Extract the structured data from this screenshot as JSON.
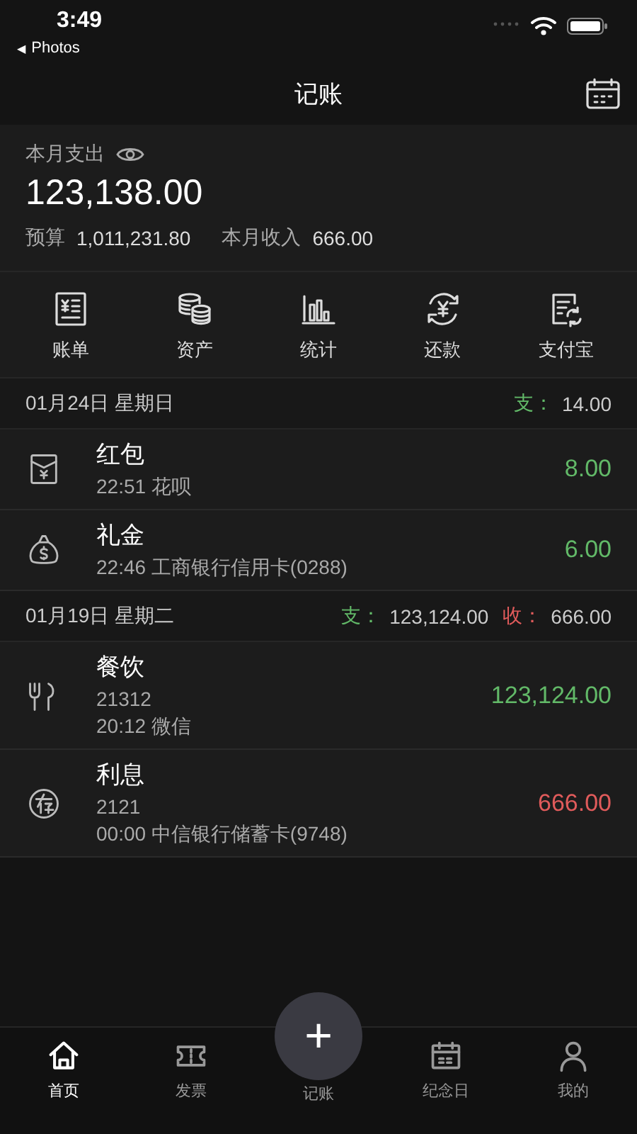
{
  "status_bar": {
    "time": "3:49",
    "back_arrow": "◀",
    "back_label": "Photos"
  },
  "nav": {
    "title": "记账"
  },
  "summary": {
    "label": "本月支出",
    "amount": "123,138.00",
    "budget_label": "预算",
    "budget": "1,011,231.80",
    "income_label": "本月收入",
    "income": "666.00"
  },
  "shortcuts": [
    {
      "label": "账单"
    },
    {
      "label": "资产"
    },
    {
      "label": "统计"
    },
    {
      "label": "还款"
    },
    {
      "label": "支付宝"
    }
  ],
  "days": [
    {
      "date": "01月24日",
      "weekday": "星期日",
      "totals": [
        {
          "kind": "expense",
          "label": "支：",
          "value": "14.00"
        }
      ],
      "entries": [
        {
          "kind": "expense",
          "category": "红包",
          "detail": "22:51 花呗",
          "amount": "8.00"
        },
        {
          "kind": "expense",
          "category": "礼金",
          "detail": "22:46 工商银行信用卡(0288)",
          "amount": "6.00"
        }
      ]
    },
    {
      "date": "01月19日",
      "weekday": "星期二",
      "totals": [
        {
          "kind": "expense",
          "label": "支：",
          "value": "123,124.00"
        },
        {
          "kind": "income",
          "label": "收：",
          "value": "666.00"
        }
      ],
      "entries": [
        {
          "kind": "expense",
          "category": "餐饮",
          "note": "21312",
          "detail": "20:12 微信",
          "amount": "123,124.00"
        },
        {
          "kind": "income",
          "category": "利息",
          "note": "2121",
          "detail": "00:00 中信银行储蓄卡(9748)",
          "amount": "666.00"
        }
      ]
    }
  ],
  "tab_bar": [
    {
      "kind": "tab",
      "label": "首页",
      "selected": true
    },
    {
      "kind": "tab",
      "label": "发票",
      "selected": false
    },
    {
      "kind": "add",
      "symbol": "+",
      "label": "记账",
      "selected": false
    },
    {
      "kind": "tab",
      "label": "纪念日",
      "selected": false
    },
    {
      "kind": "tab",
      "label": "我的",
      "selected": false
    }
  ]
}
